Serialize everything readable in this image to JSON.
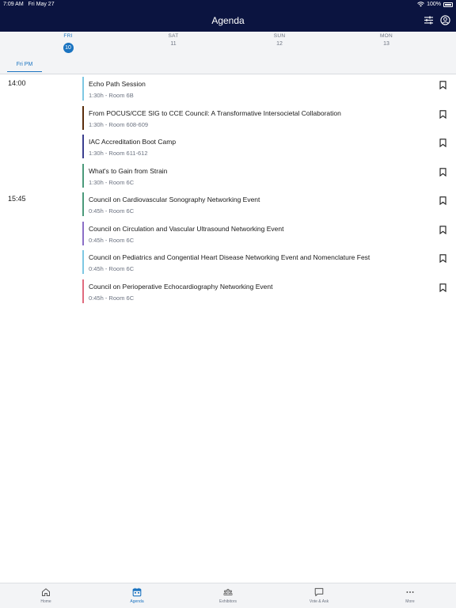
{
  "status": {
    "time": "7:09 AM",
    "date": "Fri May 27",
    "battery": "100%"
  },
  "nav": {
    "title": "Agenda"
  },
  "days": [
    {
      "name": "FRI",
      "num": "10",
      "active": true
    },
    {
      "name": "SAT",
      "num": "11",
      "active": false
    },
    {
      "name": "SUN",
      "num": "12",
      "active": false
    },
    {
      "name": "MON",
      "num": "13",
      "active": false
    }
  ],
  "tab": {
    "label": "Fri PM"
  },
  "times": [
    "14:00",
    "15:45"
  ],
  "sessions": [
    {
      "title": "Echo Path Session",
      "meta": "1:30h - Room 6B",
      "color": "#7ec8e3"
    },
    {
      "title": "From POCUS/CCE SIG to CCE Council: A Transformative Intersocietal Collaboration",
      "meta": "1:30h - Room 608-609",
      "color": "#5a2d0c"
    },
    {
      "title": "IAC Accreditation Boot Camp",
      "meta": "1:30h - Room 611-612",
      "color": "#3b3f8f"
    },
    {
      "title": "What's to Gain from Strain",
      "meta": "1:30h - Room 6C",
      "color": "#4a9a7a"
    },
    {
      "title": "Council on Cardiovascular Sonography Networking Event",
      "meta": "0:45h - Room 6C",
      "color": "#4a9a7a"
    },
    {
      "title": "Council on Circulation and Vascular Ultrasound Networking Event",
      "meta": "0:45h - Room 6C",
      "color": "#8b6fc7"
    },
    {
      "title": "Council on Pediatrics and Congential Heart Disease Networking Event and Nomenclature Fest",
      "meta": "0:45h - Room 6C",
      "color": "#7ec8e3"
    },
    {
      "title": "Council on Perioperative Echocardiography Networking Event",
      "meta": "0:45h - Room 6C",
      "color": "#e06b7e"
    }
  ],
  "bottom_tabs": [
    {
      "label": "Home",
      "icon": "home-icon",
      "active": false
    },
    {
      "label": "Agenda",
      "icon": "calendar-icon",
      "active": true
    },
    {
      "label": "Exhibitors",
      "icon": "exhibitors-icon",
      "active": false
    },
    {
      "label": "Vote & Ask",
      "icon": "chat-icon",
      "active": false
    },
    {
      "label": "More",
      "icon": "more-icon",
      "active": false
    }
  ],
  "colors": {
    "navy": "#0b1440",
    "accent": "#1a73c0"
  }
}
